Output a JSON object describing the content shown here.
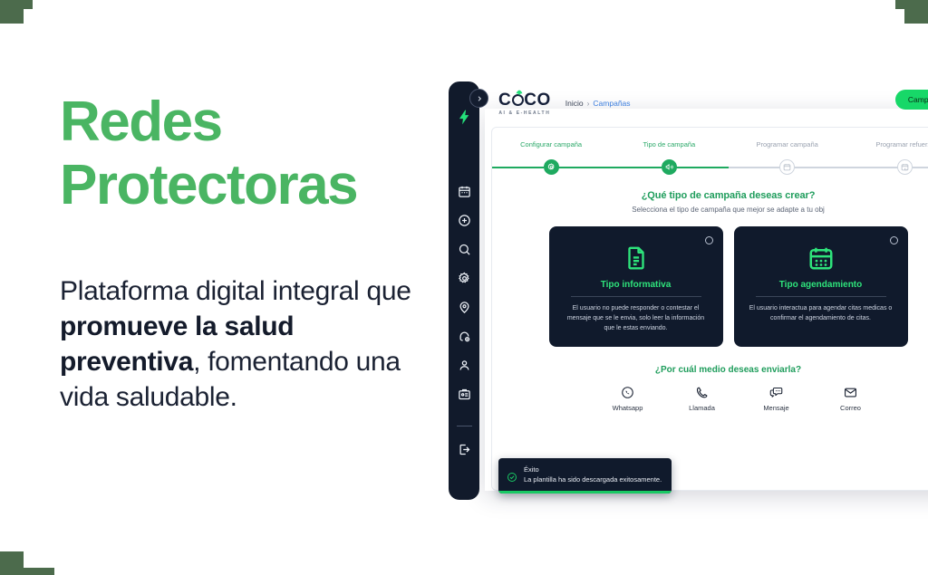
{
  "slide": {
    "headline_line1": "Redes",
    "headline_line2": "Protectoras",
    "headline_color": "#4ab563",
    "body": {
      "part1": "Plataforma digital integral que ",
      "bold1": "promueve la salud preventiva",
      "part2": ", fomentando una vida saludable."
    },
    "corner_accent_color": "#4c6b4c"
  },
  "app": {
    "sidebar": {
      "logo_icon": "lightning-bolt-icon",
      "collapse_icon": "chevron-right-icon",
      "items": [
        {
          "icon": "calendar-icon"
        },
        {
          "icon": "plus-circle-icon"
        },
        {
          "icon": "search-icon"
        },
        {
          "icon": "gear-icon"
        },
        {
          "icon": "location-pin-icon"
        },
        {
          "icon": "headset-support-icon"
        },
        {
          "icon": "user-icon"
        },
        {
          "icon": "id-badge-icon"
        }
      ],
      "logout_icon": "logout-icon"
    },
    "header": {
      "logo_text_left": "C",
      "logo_text_right": "CO",
      "logo_subtitle": "AI & E-HEALTH",
      "breadcrumb": {
        "root": "Inicio",
        "separator": "›",
        "current": "Campañas"
      },
      "action_button": "Campañas",
      "action_button_color": "#17d868"
    },
    "stepper": {
      "active_color": "#1faa60",
      "inactive_color": "#cfd5de",
      "steps": [
        {
          "label": "Configurar campaña",
          "state": "done",
          "icon": "gear-icon"
        },
        {
          "label": "Tipo de campaña",
          "state": "done",
          "icon": "campaign-type-icon"
        },
        {
          "label": "Programar campaña",
          "state": "pending",
          "icon": "calendar-icon"
        },
        {
          "label": "Programar refuerzo",
          "state": "pending",
          "icon": "calendar-refresh-icon"
        }
      ]
    },
    "question": {
      "title": "¿Qué tipo de campaña deseas crear?",
      "subtitle": "Selecciona el tipo de campaña que mejor se adapte a tu obj",
      "title_color": "#1f9d5c"
    },
    "options": [
      {
        "icon": "document-text-icon",
        "title": "Tipo informativa",
        "description": "El usuario no puede responder o contestar el mensaje que se le envia, solo leer la información que le estas enviando.",
        "selected": false
      },
      {
        "icon": "calendar-icon",
        "title": "Tipo agendamiento",
        "description": "El usuario interactua para agendar citas medicas o confirmar el agendamiento de citas.",
        "selected": false
      }
    ],
    "channel_section": {
      "title": "¿Por cuál medio deseas enviarla?",
      "channels": [
        {
          "icon": "whatsapp-icon",
          "label": "Whatsapp"
        },
        {
          "icon": "phone-call-icon",
          "label": "Llamada"
        },
        {
          "icon": "chat-message-icon",
          "label": "Mensaje"
        },
        {
          "icon": "email-envelope-icon",
          "label": "Correo"
        }
      ]
    },
    "toast": {
      "icon": "check-circle-icon",
      "title": "Éxito",
      "message": "La plantilla ha sido descargada exitosamente.",
      "accent_color": "#19c964"
    }
  }
}
